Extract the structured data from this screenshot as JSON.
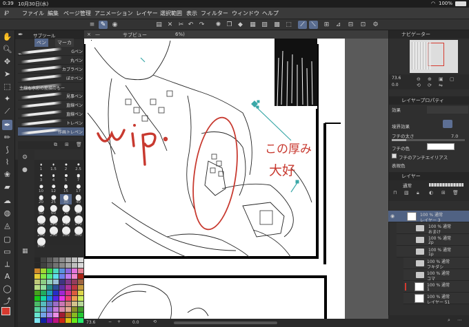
{
  "status": {
    "time": "0:39",
    "date": "10月30日(水)",
    "battery": "100%"
  },
  "menu": [
    "ファイル",
    "編集",
    "ページ管理",
    "アニメーション",
    "レイヤー",
    "選択範囲",
    "表示",
    "フィルター",
    "ウィンドウ",
    "ヘルプ"
  ],
  "subtool": {
    "header": "サブツール",
    "tabs": [
      "ペン",
      "マーカ"
    ],
    "brushes": [
      {
        "label": "Gペン"
      },
      {
        "label": "丸ペン"
      },
      {
        "label": "カブラペン"
      },
      {
        "label": "ぼかペン"
      },
      {
        "label": "主線も水彩の筋描のもー"
      },
      {
        "label": "見事ペン"
      },
      {
        "label": "直線ペン"
      },
      {
        "label": "直線ペン"
      },
      {
        "label": "トレペン"
      },
      {
        "label": "作画トレペン"
      }
    ]
  },
  "brush_sizes": [
    "1",
    "1.5",
    "2",
    "2.5",
    "3",
    "4",
    "5",
    "7",
    "10",
    "12",
    "15",
    "17",
    "20",
    "25",
    "30",
    "40",
    "50",
    "60",
    "70",
    "80",
    "100",
    "120",
    "150",
    "170",
    "200",
    "250",
    "300",
    "400",
    "500"
  ],
  "canvas": {
    "tab_label": "サブビュー",
    "zoom": "73.6",
    "angle": "0.0",
    "annotation_wip": "wip.",
    "annotation_note_line1": "この厚み",
    "annotation_note_line2": "大好"
  },
  "navigator": {
    "title": "ナビゲーター",
    "zoom": "73.6",
    "angle": "0.0"
  },
  "layer_property": {
    "title": "レイヤープロパティ",
    "effect_label": "効果",
    "border_effect_label": "境界効果",
    "thickness_label": "フチの太さ",
    "thickness_value": "7.0",
    "color_label": "フチの色",
    "antialias_label": "フチのアンチエイリアス",
    "expression_color_label": "表現色"
  },
  "layers": {
    "title": "レイヤー",
    "blend_mode": "通常",
    "opacity": "100",
    "items": [
      {
        "line1": "100 % 通常",
        "line2": "レイヤー 3",
        "kind": "raster",
        "selected": true
      },
      {
        "line1": "100 % 通常",
        "line2": "おまけ",
        "kind": "folder"
      },
      {
        "line1": "100 % 通常",
        "line2": "2p",
        "kind": "folder"
      },
      {
        "line1": "100 % 通常",
        "line2": "1p",
        "kind": "folder"
      },
      {
        "line1": "100 % 通常",
        "line2": "フキダシ",
        "kind": "folder"
      },
      {
        "line1": "100 % 通常",
        "line2": "コマ",
        "kind": "folder"
      },
      {
        "line1": "100 % 通常",
        "line2": "1",
        "kind": "raster"
      },
      {
        "line1": "100 % 通常",
        "line2": "レイヤー 51",
        "kind": "raster"
      }
    ]
  },
  "colors": {
    "accent": "#5d6f94",
    "annotation_red": "#c83a30",
    "annotation_teal": "#3aa8a8",
    "main_color": "#d63a2f"
  }
}
